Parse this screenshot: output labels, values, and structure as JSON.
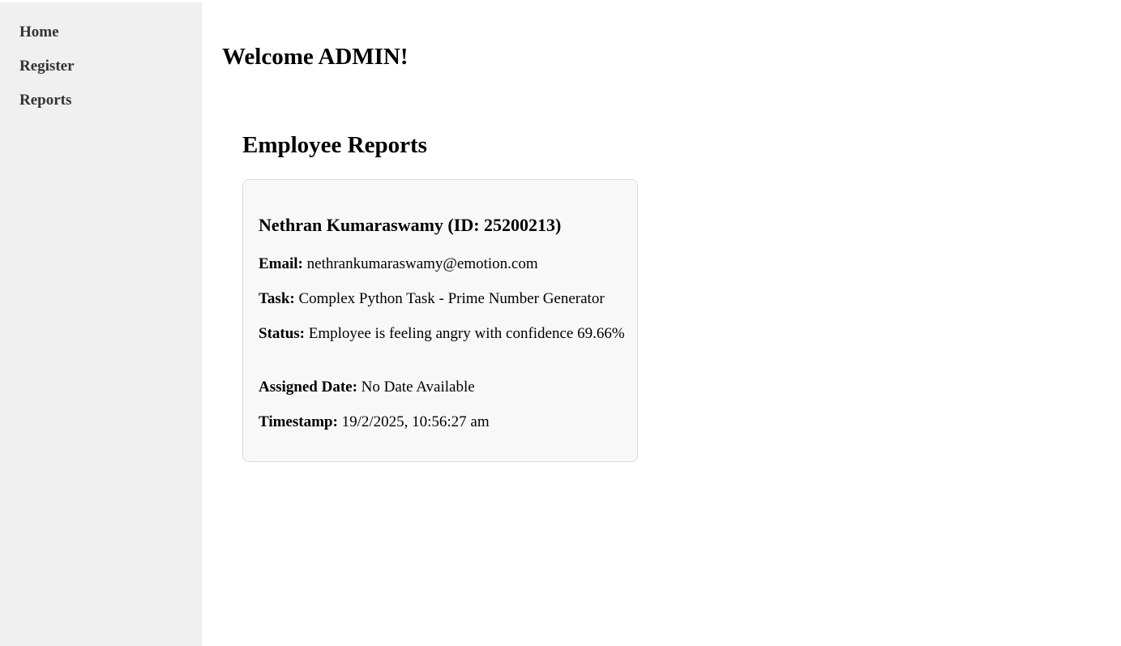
{
  "sidebar": {
    "items": [
      {
        "label": "Home"
      },
      {
        "label": "Register"
      },
      {
        "label": "Reports"
      }
    ]
  },
  "main": {
    "welcome": "Welcome ADMIN!",
    "section_title": "Employee Reports",
    "report": {
      "title": "Nethran Kumaraswamy (ID: 25200213)",
      "email_label": "Email:",
      "email": "nethrankumaraswamy@emotion.com",
      "task_label": "Task:",
      "task": "Complex Python Task - Prime Number Generator",
      "status_label": "Status:",
      "status": "Employee is feeling angry with confidence 69.66%",
      "assigned_label": "Assigned Date:",
      "assigned": "No Date Available",
      "timestamp_label": "Timestamp:",
      "timestamp": "19/2/2025, 10:56:27 am"
    }
  },
  "colors": {
    "sidebar_bg": "#f0f0f0",
    "nav_text": "#333333",
    "card_bg": "#f8f8f8",
    "card_border": "#dddddd"
  }
}
